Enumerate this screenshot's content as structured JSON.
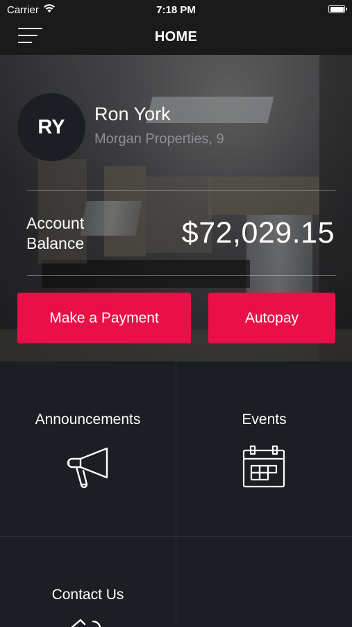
{
  "status_bar": {
    "carrier": "Carrier",
    "time": "7:18 PM",
    "wifi_icon": "wifi-icon",
    "battery_icon": "battery-icon"
  },
  "nav": {
    "title": "HOME",
    "menu_icon": "hamburger-menu-icon"
  },
  "profile": {
    "initials": "RY",
    "name": "Ron York",
    "property": "Morgan Properties, 9"
  },
  "balance": {
    "label_line1": "Account",
    "label_line2": "Balance",
    "amount": "$72,029.15"
  },
  "actions": {
    "make_payment": "Make a Payment",
    "autopay": "Autopay"
  },
  "tiles": [
    {
      "label": "Announcements",
      "icon": "megaphone-icon"
    },
    {
      "label": "Events",
      "icon": "calendar-icon"
    },
    {
      "label": "Contact Us",
      "icon": "contact-icon"
    },
    {
      "label": "",
      "icon": ""
    }
  ],
  "colors": {
    "accent": "#ea0f47",
    "background": "#1b1e22",
    "bar": "#1a1a1a",
    "muted_text": "#8d8f92"
  }
}
